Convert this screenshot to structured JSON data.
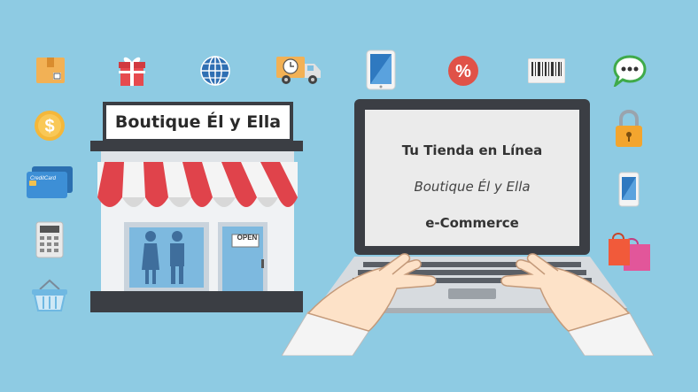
{
  "store": {
    "sign_text": "Boutique Él y Ella",
    "door_sign": "OPEN"
  },
  "laptop": {
    "line1": "Tu Tienda en Línea",
    "line2": "Boutique Él y Ella",
    "line3": "e-Commerce"
  },
  "icons": {
    "credit_card": "CreditCard",
    "top_row": [
      "package-icon",
      "gift-icon",
      "globe-icon",
      "delivery-truck-icon",
      "tablet-icon",
      "discount-icon",
      "barcode-icon",
      "chat-icon"
    ],
    "left_column": [
      "dollar-coin-icon",
      "credit-card-icon",
      "calculator-icon",
      "shopping-basket-icon"
    ],
    "right_column": [
      "padlock-icon",
      "smartphone-icon",
      "shopping-bags-icon"
    ]
  },
  "colors": {
    "background": "#8ecbe3",
    "awning_red": "#e0434b",
    "dark": "#3b3e44"
  }
}
